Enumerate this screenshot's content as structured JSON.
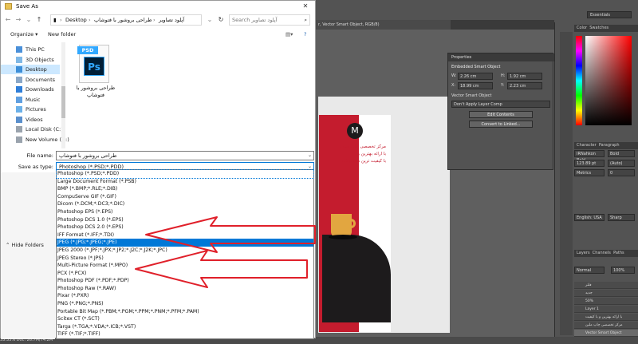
{
  "photoshop": {
    "doc_tab": "r, Vector Smart Object, RGB/8)",
    "workspace": "Essentials",
    "panel_tabs": [
      "Color",
      "Swatches"
    ],
    "properties": {
      "tab": "Properties",
      "title": "Embedded Smart Object",
      "w_label": "W:",
      "w_value": "2.26 cm",
      "h_label": "H:",
      "h_value": "1.92 cm",
      "x_label": "X:",
      "x_value": "18.99 cm",
      "y_label": "Y:",
      "y_value": "2.23 cm",
      "vector_label": "Vector Smart Object",
      "layer_comp": "Don't Apply Layer Comp",
      "edit_btn": "Edit Contents",
      "convert_btn": "Convert to Linked..."
    },
    "character": {
      "tabs": [
        "Character",
        "Paragraph"
      ],
      "font": "IRNahkon Bold",
      "style": "Bold",
      "size": "123.89 pt",
      "leading": "(Auto)",
      "kerning": "Metrics",
      "tracking": "0",
      "lang": "English: USA",
      "aa": "Sharp"
    },
    "layers": {
      "tabs": [
        "Layers",
        "Channels",
        "Paths"
      ],
      "blend": "Normal",
      "opacity": "100%",
      "rows": [
        "فلتر",
        "جدید",
        "50%",
        "Layer 1",
        "با ارائه بهترین و با کیفیت",
        "مرکز تخصصی چاپ ملین",
        "Vector Smart Object"
      ]
    },
    "status": "33.33%      Doc: 26.7M/74.2M",
    "doc_text": [
      "مرکز تخصصی چاپ ملین",
      "با ارائه بهترین و",
      "با کیفیت ترین محصولات"
    ]
  },
  "dialog": {
    "title": "Save As",
    "breadcrumb": [
      "Desktop",
      "طراحی بروشور با فتوشاپ",
      "آپلود تصاویر"
    ],
    "search_placeholder": "Search آپلود تصاویر",
    "organize": "Organize ▾",
    "new_folder": "New folder",
    "nav_items": [
      "This PC",
      "3D Objects",
      "Desktop",
      "Documents",
      "Downloads",
      "Music",
      "Pictures",
      "Videos",
      "Local Disk (C:)",
      "New Volume (D:)"
    ],
    "selected_nav": "Desktop",
    "file": {
      "tag": "PSD",
      "ps": "Ps",
      "name": "طراحی بروشور با فتوشاپ"
    },
    "file_name_label": "File name:",
    "file_name_value": "طراحی بروشور با فتوشاپ",
    "save_type_label": "Save as type:",
    "save_type_value": "Photoshop (*.PSD;*.PDD)",
    "hide_folders": "Hide Folders",
    "file_types": [
      "Photoshop (*.PSD;*.PDD)",
      "Large Document Format (*.PSB)",
      "BMP (*.BMP;*.RLE;*.DIB)",
      "CompuServe GIF (*.GIF)",
      "Dicom (*.DCM;*.DC3;*.DIC)",
      "Photoshop EPS (*.EPS)",
      "Photoshop DCS 1.0 (*.EPS)",
      "Photoshop DCS 2.0 (*.EPS)",
      "IFF Format (*.IFF;*.TDI)",
      "JPEG (*.JPG;*.JPEG;*.JPE)",
      "JPEG 2000 (*.JPF;*.JPX;*.JP2;*.J2C;*.J2K;*.JPC)",
      "JPEG Stereo (*.JPS)",
      "Multi-Picture Format (*.MPO)",
      "PCX (*.PCX)",
      "Photoshop PDF (*.PDF;*.PDP)",
      "Photoshop Raw (*.RAW)",
      "Pixar (*.PXR)",
      "PNG (*.PNG;*.PNS)",
      "Portable Bit Map (*.PBM;*.PGM;*.PPM;*.PNM;*.PFM;*.PAM)",
      "Scitex CT (*.SCT)",
      "Targa (*.TGA;*.VDA;*.ICB;*.VST)",
      "TIFF (*.TIF;*.TIFF)"
    ],
    "highlighted_type": "JPEG (*.JPG;*.JPEG;*.JPE)"
  },
  "colors": {
    "accent": "#0078d7",
    "selection": "#cce8ff",
    "arrow": "#e0202a"
  }
}
